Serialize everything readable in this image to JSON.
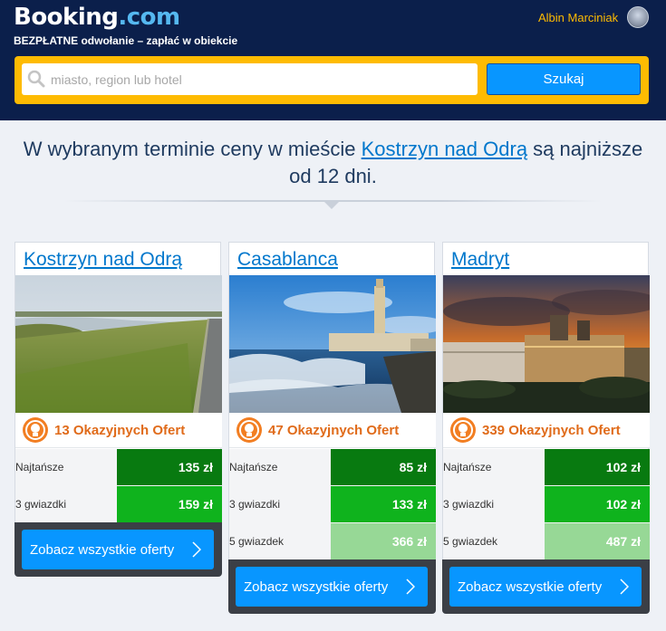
{
  "header": {
    "logo_main": "Booking",
    "logo_suffix": ".com",
    "tagline": "BEZPŁATNE odwołanie – zapłać w obiekcie",
    "user_name": "Albin Marciniak"
  },
  "search": {
    "placeholder": "miasto, region lub hotel",
    "value": "",
    "button_label": "Szukaj"
  },
  "message": {
    "part1": "W wybranym terminie ceny w mieście ",
    "city": "Kostrzyn nad Odrą",
    "part2": " są najniższe od 12 dni."
  },
  "colors": {
    "header_bg": "#0b1f4b",
    "search_border": "#febb02",
    "accent_blue": "#0896ff",
    "price_dark": "#087a10",
    "price_mid": "#0fb31d",
    "price_light": "#97d896",
    "deal_orange": "#e06b1a"
  },
  "cards": [
    {
      "title": "Kostrzyn nad Odrą",
      "photo": "river-meadow-photo",
      "deals": "13 Okazyjnych Ofert",
      "prices": [
        {
          "label": "Najtańsze",
          "value": "135 zł"
        },
        {
          "label": "3 gwiazdki",
          "value": "159 zł"
        }
      ],
      "cta": "Zobacz wszystkie oferty"
    },
    {
      "title": "Casablanca",
      "photo": "mosque-coast-photo",
      "deals": "47 Okazyjnych Ofert",
      "prices": [
        {
          "label": "Najtańsze",
          "value": "85 zł"
        },
        {
          "label": "3 gwiazdki",
          "value": "133 zł"
        },
        {
          "label": "5 gwiazdek",
          "value": "366 zł"
        }
      ],
      "cta": "Zobacz wszystkie oferty"
    },
    {
      "title": "Madryt",
      "photo": "royal-palace-sunset-photo",
      "deals": "339 Okazyjnych Ofert",
      "prices": [
        {
          "label": "Najtańsze",
          "value": "102 zł"
        },
        {
          "label": "3 gwiazdki",
          "value": "102 zł"
        },
        {
          "label": "5 gwiazdek",
          "value": "487 zł"
        }
      ],
      "cta": "Zobacz wszystkie oferty"
    }
  ]
}
